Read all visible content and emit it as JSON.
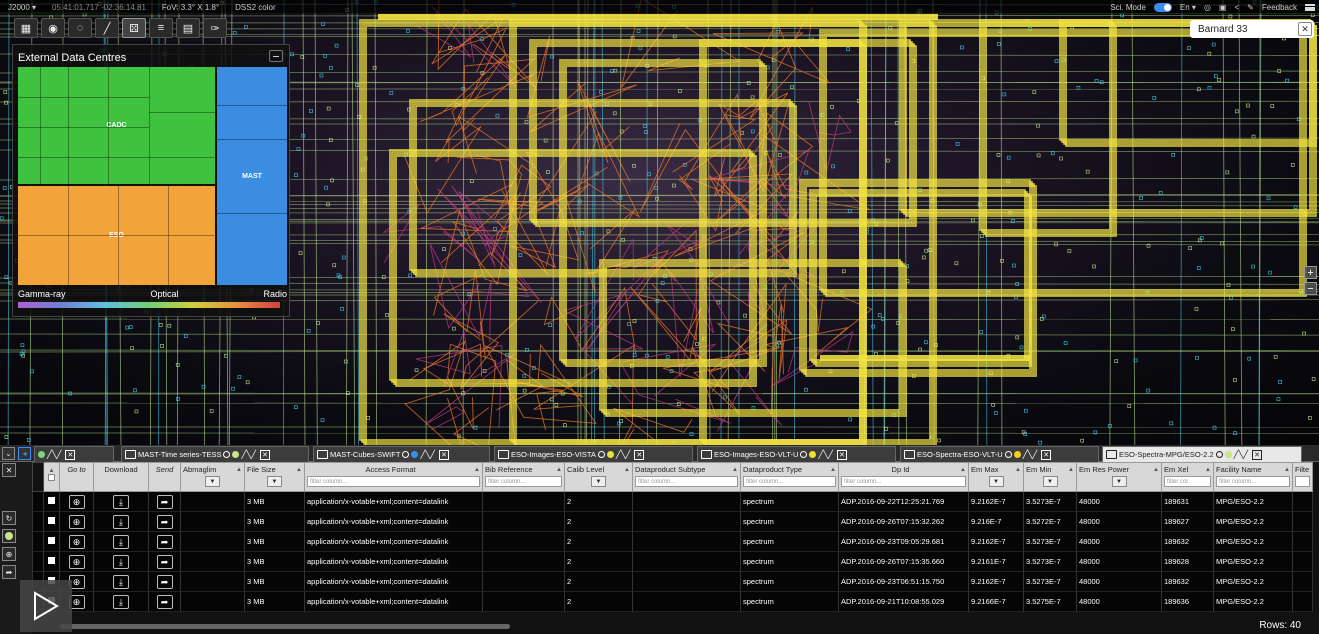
{
  "topbar": {
    "coord_frame": "J2000 ▾",
    "coordinates": "05:41:01.717 -02:36:14.81",
    "fov": "FoV: 3.3° X 1.8°",
    "survey": "DSS2 color",
    "sci_mode_label": "Sci. Mode",
    "language": "En ▾",
    "feedback_label": "Feedback"
  },
  "edc": {
    "title": "External Data Centres",
    "cells": [
      "CADC",
      "MAST",
      "ESO"
    ],
    "spectrum": [
      "Gamma-ray",
      "Optical",
      "Radio"
    ]
  },
  "search": {
    "value": "Barnard 33",
    "clear": "✕"
  },
  "tabs": [
    {
      "label": "",
      "dot": "#7ed67e",
      "active": false
    },
    {
      "label": "MAST-Time series-TESS",
      "dot": "#c8e68c",
      "active": false
    },
    {
      "label": "MAST-Cubes-SWIFT",
      "dot": "#3a8df0",
      "active": false
    },
    {
      "label": "ESO-Images-ESO-VISTA",
      "dot": "#e8e040",
      "active": false
    },
    {
      "label": "ESO-Images-ESO-VLT-U",
      "dot": "#f0e030",
      "active": false
    },
    {
      "label": "ESO-Spectra-ESO-VLT-U",
      "dot": "#f0d020",
      "active": false
    },
    {
      "label": "ESO-Spectra-MPG/ESO-2.2",
      "dot": "#c8e68c",
      "active": true
    }
  ],
  "table": {
    "headers": [
      "Go to",
      "Download",
      "Send",
      "Abmaglim",
      "File Size",
      "Access Format",
      "Bib Reference",
      "Calib Level",
      "Dataproduct Subtype",
      "Dataproduct Type",
      "Dp Id",
      "Em Max",
      "Em Min",
      "Em Res Power",
      "Em Xel",
      "Facility Name",
      "Filte"
    ],
    "filter_placeholder": "filter column...",
    "filter_placeholder_short": "filter col",
    "rows": [
      [
        "3 MB",
        "application/x-votable+xml;content=datalink",
        "2",
        "spectrum",
        "ADP.2016-09-22T12:25:21.769",
        "9.2162E-7",
        "3.5273E-7",
        "48000",
        "189631",
        "MPG/ESO-2.2"
      ],
      [
        "3 MB",
        "application/x-votable+xml;content=datalink",
        "2",
        "spectrum",
        "ADP.2016-09-26T07:15:32.262",
        "9.216E-7",
        "3.5272E-7",
        "48000",
        "189627",
        "MPG/ESO-2.2"
      ],
      [
        "3 MB",
        "application/x-votable+xml;content=datalink",
        "2",
        "spectrum",
        "ADP.2016-09-23T09:05:29.681",
        "9.2162E-7",
        "3.5273E-7",
        "48000",
        "189632",
        "MPG/ESO-2.2"
      ],
      [
        "3 MB",
        "application/x-votable+xml;content=datalink",
        "2",
        "spectrum",
        "ADP.2016-09-26T07:15:35.660",
        "9.2161E-7",
        "3.5273E-7",
        "48000",
        "189628",
        "MPG/ESO-2.2"
      ],
      [
        "3 MB",
        "application/x-votable+xml;content=datalink",
        "2",
        "spectrum",
        "ADP.2016-09-23T06:51:15.750",
        "9.2162E-7",
        "3.5273E-7",
        "48000",
        "189632",
        "MPG/ESO-2.2"
      ],
      [
        "3 MB",
        "application/x-votable+xml;content=datalink",
        "2",
        "spectrum",
        "ADP.2016-09-21T10:08:55.029",
        "9.2166E-7",
        "3.5275E-7",
        "48000",
        "189636",
        "MPG/ESO-2.2"
      ]
    ],
    "rows_label": "Rows: 40"
  },
  "icons": {
    "goto": "target-icon",
    "download": "download-icon",
    "send": "share-icon",
    "play": "play-icon"
  },
  "colors": {
    "cadc": "#3fc23f",
    "mast": "#3a8de0",
    "eso": "#f2a43a",
    "footprint_yellow": "#f5e642",
    "footprint_orange": "#f07a2a",
    "footprint_green": "#b8e08c",
    "footprint_cyan": "#40c8e0"
  }
}
